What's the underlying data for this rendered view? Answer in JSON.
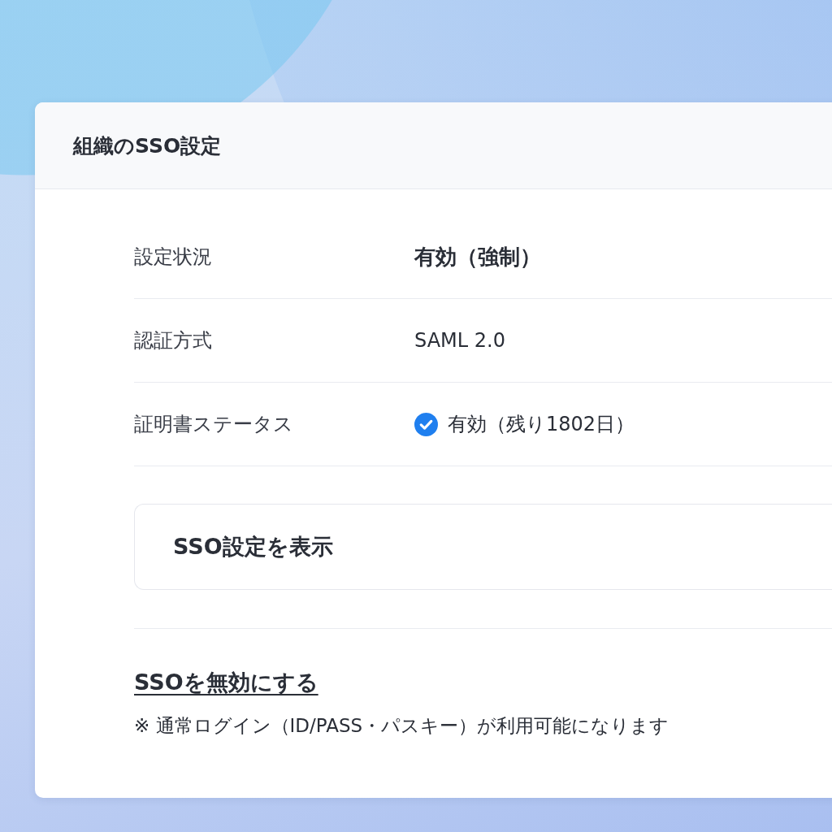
{
  "card": {
    "title": "組織のSSO設定"
  },
  "fields": [
    {
      "label": "設定状況",
      "value": "有効（強制）",
      "kind": "emphasis"
    },
    {
      "label": "認証方式",
      "value": "SAML 2.0",
      "kind": "text"
    },
    {
      "label": "証明書ステータス",
      "value": "有効（残り1802日）",
      "kind": "verified"
    }
  ],
  "view_button": {
    "label": "SSO設定を表示"
  },
  "disable_link": {
    "label": "SSOを無効にする"
  },
  "note": "※ 通常ログイン（ID/PASS・パスキー）が利用可能になります"
}
